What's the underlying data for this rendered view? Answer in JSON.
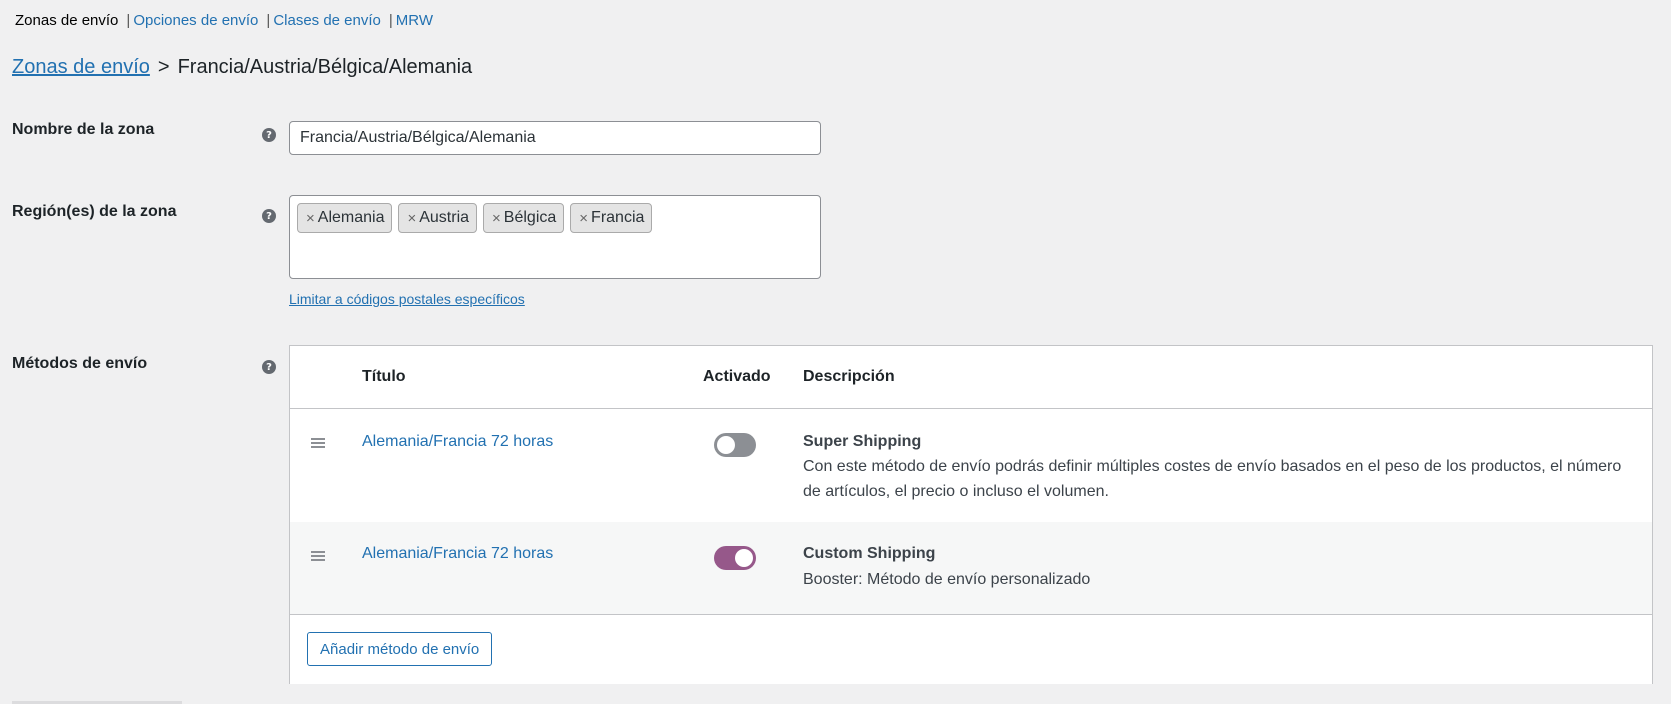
{
  "subnav": {
    "current": "Zonas de envío",
    "links": [
      "Opciones de envío",
      "Clases de envío",
      "MRW"
    ],
    "separator": "|"
  },
  "breadcrumb": {
    "parent": "Zonas de envío",
    "arrow": ">",
    "current": "Francia/Austria/Bélgica/Alemania"
  },
  "zone_name": {
    "label": "Nombre de la zona",
    "value": "Francia/Austria/Bélgica/Alemania"
  },
  "zone_regions": {
    "label": "Región(es) de la zona",
    "remove_glyph": "×",
    "chips": [
      "Alemania",
      "Austria",
      "Bélgica",
      "Francia"
    ],
    "postcode_link": "Limitar a códigos postales específicos"
  },
  "shipping_methods": {
    "label": "Métodos de envío",
    "columns": {
      "title": "Título",
      "enabled": "Activado",
      "description": "Descripción"
    },
    "rows": [
      {
        "title": "Alemania/Francia 72 horas",
        "enabled": false,
        "desc_title": "Super Shipping",
        "desc_text": "Con este método de envío podrás definir múltiples costes de envío basados en el peso de los productos, el número de artículos, el precio o incluso el volumen."
      },
      {
        "title": "Alemania/Francia 72 horas",
        "enabled": true,
        "desc_title": "Custom Shipping",
        "desc_text": "Booster: Método de envío personalizado"
      }
    ],
    "add_button": "Añadir método de envío"
  },
  "help_glyph": "?",
  "colors": {
    "link": "#2271b1",
    "toggle_on": "#96588a",
    "toggle_off": "#8c8f94",
    "background": "#f0f0f1"
  }
}
